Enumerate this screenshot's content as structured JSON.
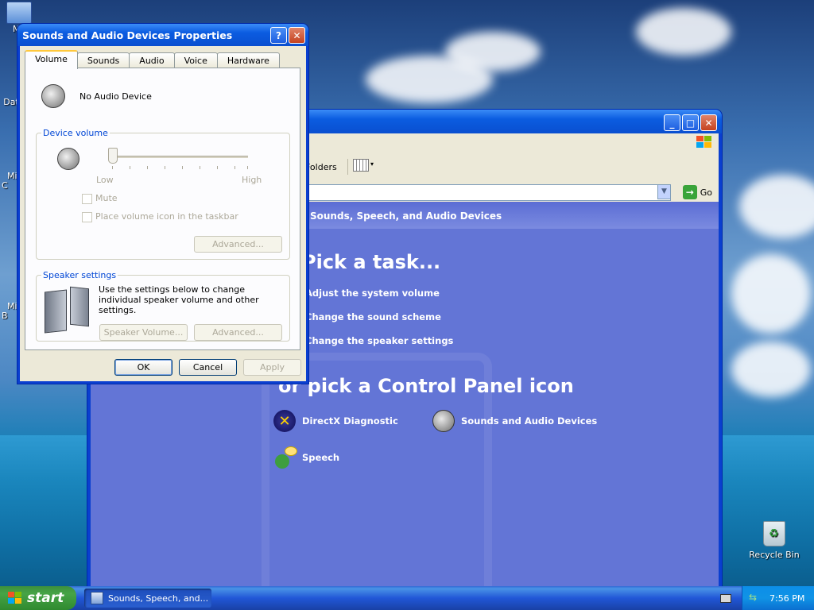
{
  "desktop": {
    "icons": [
      {
        "label": "My"
      },
      {
        "label": "Dat"
      },
      {
        "label": "Micr\nC"
      },
      {
        "label": "Micr\nB"
      },
      {
        "label": "Recycle Bin"
      }
    ]
  },
  "cp_window": {
    "menu_labels": [],
    "toolbar": {
      "folders_label": "Folders"
    },
    "address": {
      "go_label": "Go"
    },
    "header": "Sounds, Speech, and Audio Devices",
    "pick_task": "Pick a task...",
    "tasks": [
      "Adjust the system volume",
      "Change the sound scheme",
      "Change the speaker settings"
    ],
    "pick_icon": "or pick a Control Panel icon",
    "items": [
      {
        "label": "DirectX Diagnostic",
        "icon": "directx-icon"
      },
      {
        "label": "Sounds and Audio Devices",
        "icon": "speaker-icon"
      },
      {
        "label": "Speech",
        "icon": "speech-icon"
      }
    ]
  },
  "dialog": {
    "title": "Sounds and Audio Devices Properties",
    "tabs": [
      "Volume",
      "Sounds",
      "Audio",
      "Voice",
      "Hardware"
    ],
    "active_tab": "Volume",
    "device_name": "No Audio Device",
    "device_volume": {
      "legend": "Device volume",
      "low_label": "Low",
      "high_label": "High",
      "mute_label": "Mute",
      "taskbar_icon_label": "Place volume icon in the taskbar",
      "advanced_label": "Advanced..."
    },
    "speaker_settings": {
      "legend": "Speaker settings",
      "description": "Use the settings below to change individual speaker volume and other settings.",
      "speaker_volume_label": "Speaker Volume...",
      "advanced_label": "Advanced..."
    },
    "ok_label": "OK",
    "cancel_label": "Cancel",
    "apply_label": "Apply"
  },
  "taskbar": {
    "start_label": "start",
    "task_button_label": "Sounds, Speech, and...",
    "clock": "7:56 PM"
  },
  "colors": {
    "xp_blue": "#0a4fd0",
    "cp_body": "#6375d6",
    "dialog_bg": "#ece9d8"
  }
}
